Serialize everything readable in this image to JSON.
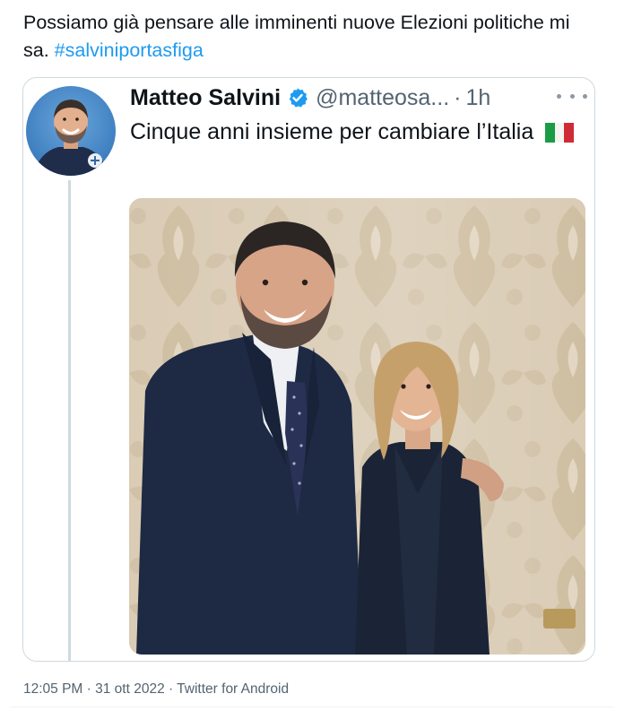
{
  "tweet": {
    "text": "Possiamo già pensare alle imminenti nuove Elezioni politiche mi sa.",
    "hashtag": "#salviniportasfiga"
  },
  "quoted_tweet": {
    "name": "Matteo Salvini",
    "handle": "@matteosa...",
    "separator": "·",
    "time": "1h",
    "text": "Cinque anni insieme per cambiare l’Italia",
    "flag_icon": "italy-flag-icon",
    "verified_icon": "verified-badge-icon",
    "more_icon": "more-options-icon"
  },
  "meta": {
    "timestamp": "12:05 PM · 31 ott 2022 · Twitter for Android"
  },
  "colors": {
    "link": "#1d9bf0",
    "secondary_text": "#536471",
    "border": "#cfd9de"
  }
}
